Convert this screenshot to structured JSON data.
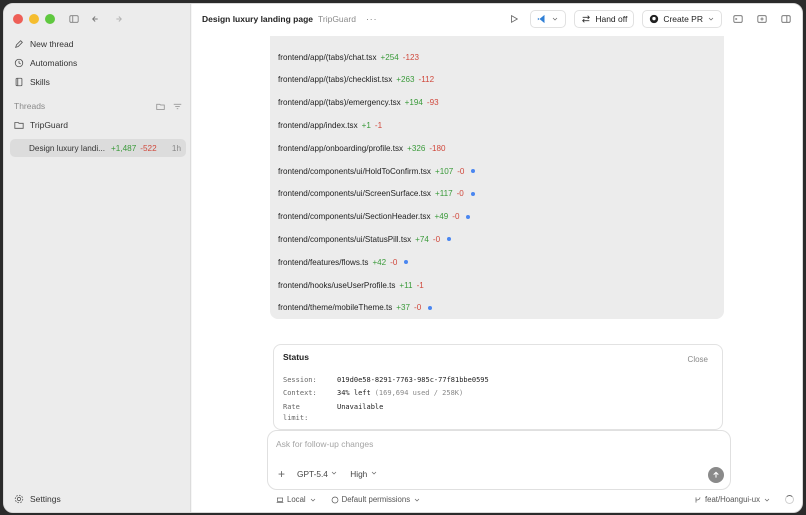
{
  "sidebar": {
    "nav": [
      {
        "label": "New thread",
        "icon": "edit-icon"
      },
      {
        "label": "Automations",
        "icon": "clock-icon"
      },
      {
        "label": "Skills",
        "icon": "book-icon"
      }
    ],
    "threads_label": "Threads",
    "project": "TripGuard",
    "thread": {
      "title": "Design luxury landi...",
      "added": "+1,487",
      "removed": "-522",
      "age": "1h"
    },
    "settings_label": "Settings"
  },
  "topbar": {
    "title": "Design luxury landing page",
    "project": "TripGuard",
    "more": "···",
    "hand_off": "Hand off",
    "create_pr": "Create PR"
  },
  "files": [
    {
      "path": "frontend/app/(tabs)/chat.tsx",
      "added": "+254",
      "removed": "-123",
      "dot": false
    },
    {
      "path": "frontend/app/(tabs)/checklist.tsx",
      "added": "+263",
      "removed": "-112",
      "dot": false
    },
    {
      "path": "frontend/app/(tabs)/emergency.tsx",
      "added": "+194",
      "removed": "-93",
      "dot": false
    },
    {
      "path": "frontend/app/index.tsx",
      "added": "+1",
      "removed": "-1",
      "dot": false
    },
    {
      "path": "frontend/app/onboarding/profile.tsx",
      "added": "+326",
      "removed": "-180",
      "dot": false
    },
    {
      "path": "frontend/components/ui/HoldToConfirm.tsx",
      "added": "+107",
      "removed": "-0",
      "dot": true
    },
    {
      "path": "frontend/components/ui/ScreenSurface.tsx",
      "added": "+117",
      "removed": "-0",
      "dot": true
    },
    {
      "path": "frontend/components/ui/SectionHeader.tsx",
      "added": "+49",
      "removed": "-0",
      "dot": true
    },
    {
      "path": "frontend/components/ui/StatusPill.tsx",
      "added": "+74",
      "removed": "-0",
      "dot": true
    },
    {
      "path": "frontend/features/flows.ts",
      "added": "+42",
      "removed": "-0",
      "dot": true
    },
    {
      "path": "frontend/hooks/useUserProfile.ts",
      "added": "+11",
      "removed": "-1",
      "dot": false
    },
    {
      "path": "frontend/theme/mobileTheme.ts",
      "added": "+37",
      "removed": "-0",
      "dot": true
    }
  ],
  "status": {
    "title": "Status",
    "close": "Close",
    "session_key": "Session:",
    "session_val": "019d0e58-8291-7763-985c-77f81bbe0595",
    "context_key": "Context:",
    "context_val": "34% left",
    "context_detail": "(169,694 used / 258K)",
    "rate_key": "Rate",
    "rate_key2": "limit:",
    "rate_val": "Unavailable"
  },
  "composer": {
    "placeholder": "Ask for follow-up changes",
    "model": "GPT-5.4",
    "effort": "High"
  },
  "footer": {
    "env": "Local",
    "permissions": "Default permissions",
    "branch": "feat/Hoangui-ux"
  },
  "colors": {
    "add": "#3a9a3a",
    "remove": "#d0483c",
    "dot": "#4a86f0"
  }
}
